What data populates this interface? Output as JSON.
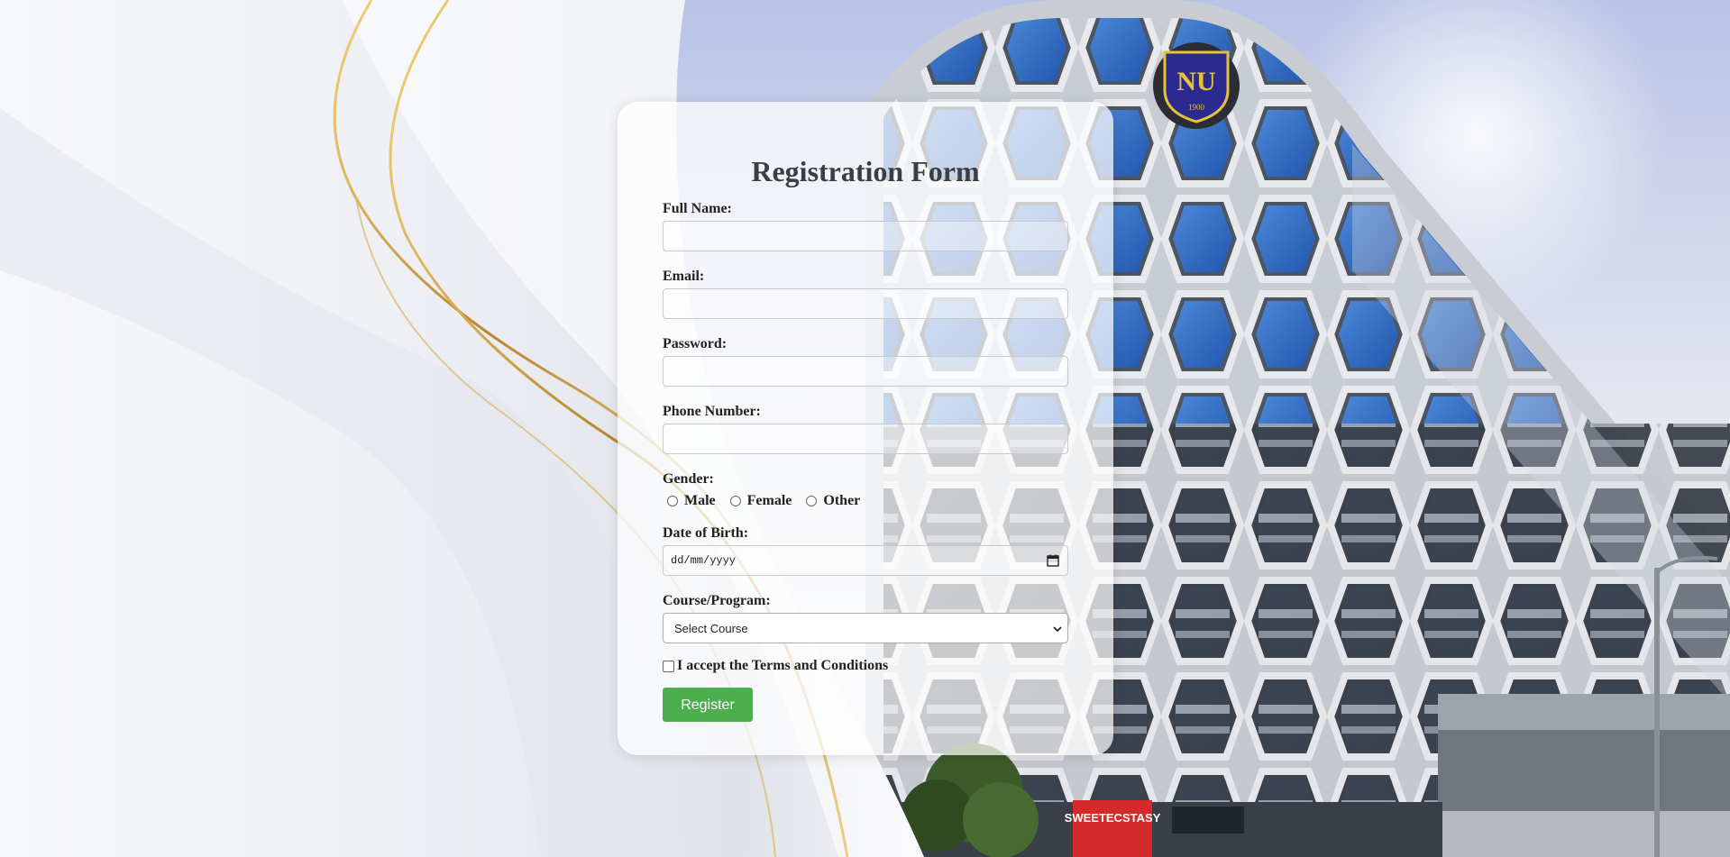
{
  "form": {
    "title": "Registration Form",
    "full_name_label": "Full Name:",
    "email_label": "Email:",
    "password_label": "Password:",
    "phone_label": "Phone Number:",
    "gender_label": "Gender:",
    "gender_options": [
      "Male",
      "Female",
      "Other"
    ],
    "dob_label": "Date of Birth:",
    "dob_placeholder": "dd/mm/yyyy",
    "course_label": "Course/Program:",
    "course_selected": "Select Course",
    "terms_label": "I accept the Terms and Conditions",
    "register_label": "Register"
  },
  "background": {
    "logo_text": "NU",
    "logo_year": "1900",
    "storefront_sign": "SWEETECSTASY"
  },
  "colors": {
    "button": "#4cae4f",
    "title": "#3b3f44",
    "logo_shield": "#2b2a8f",
    "logo_gold": "#e6c23a",
    "gold_ribbon": "#c9a14a",
    "glass_blue": "#2f6fc9",
    "sign_red": "#d42a2a"
  }
}
